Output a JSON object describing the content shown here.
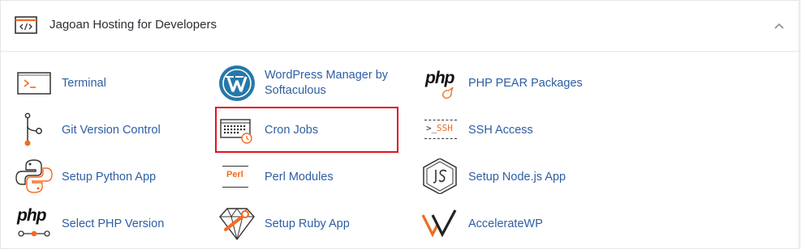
{
  "section": {
    "title": "Jagoan Hosting for Developers"
  },
  "items": [
    {
      "label": "Terminal"
    },
    {
      "label1": "WordPress Manager by",
      "label2": "Softaculous"
    },
    {
      "label": "PHP PEAR Packages"
    },
    {
      "label": "Git Version Control"
    },
    {
      "label": "Cron Jobs"
    },
    {
      "label": "SSH Access"
    },
    {
      "label": "Setup Python App"
    },
    {
      "label": "Perl Modules"
    },
    {
      "label": "Setup Node.js App"
    },
    {
      "label": "Select PHP Version"
    },
    {
      "label": "Setup Ruby App"
    },
    {
      "label": "AccelerateWP"
    }
  ],
  "icon_text": {
    "php": "php",
    "ssh": "SSH",
    "perl": "Perl",
    "prompt": ">_",
    "php2": "php"
  },
  "colors": {
    "accent": "#f26b21",
    "link": "#2d5ea3",
    "highlight": "#e2121e"
  }
}
